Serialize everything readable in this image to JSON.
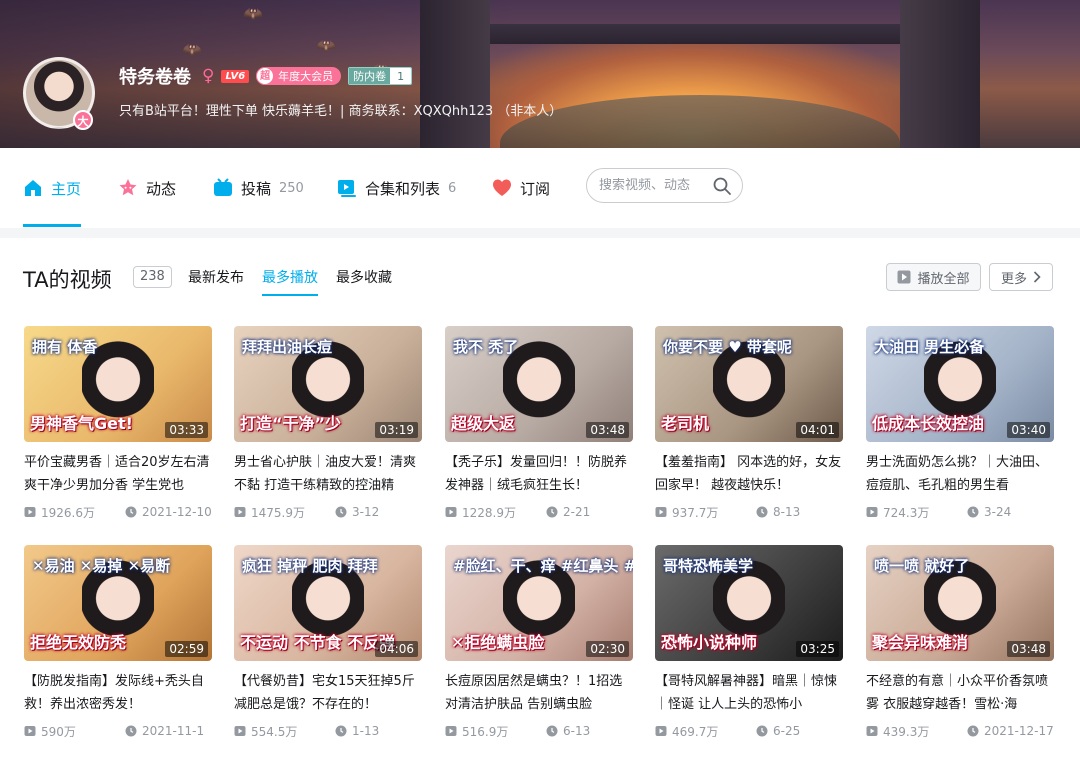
{
  "profile": {
    "name": "特务卷卷",
    "gender_symbol": "♀",
    "level": "LV6",
    "vip_mark": "超",
    "vip_label": "年度大会员",
    "fan_badge_name": "防内卷",
    "fan_badge_level": "1",
    "avatar_badge": "大",
    "sign": "只有B站平台！理性下单 快乐薅羊毛！| 商务联系：XQXQhh123 （非本人）"
  },
  "nav": {
    "items": [
      {
        "label": "主页",
        "count": "",
        "icon": "home-icon"
      },
      {
        "label": "动态",
        "count": "",
        "icon": "dynamic-icon"
      },
      {
        "label": "投稿",
        "count": "250",
        "icon": "upload-icon"
      },
      {
        "label": "合集和列表",
        "count": "6",
        "icon": "collection-icon"
      },
      {
        "label": "订阅",
        "count": "",
        "icon": "heart-icon"
      }
    ],
    "search_placeholder": "搜索视频、动态"
  },
  "colors": {
    "accent": "#00aeec",
    "pink": "#fb7299",
    "text": "#18191c",
    "muted": "#9499a0"
  },
  "videos_section": {
    "title": "TA的视频",
    "count": "238",
    "sort_tabs": [
      "最新发布",
      "最多播放",
      "最多收藏"
    ],
    "active_sort": "最多播放",
    "play_all": "播放全部",
    "more": "更多"
  },
  "videos": [
    {
      "title": "平价宝藏男香｜适合20岁左右清爽干净少男加分香 学生党也",
      "duration": "03:33",
      "plays": "1926.6万",
      "date": "2021-12-10",
      "cap_bottom": "男神香气Get!",
      "cap_top": "拥有    体香"
    },
    {
      "title": "男士省心护肤｜油皮大爱！清爽不黏 打造干练精致的控油精",
      "duration": "03:19",
      "plays": "1475.9万",
      "date": "3-12",
      "cap_bottom": "打造“干净”少",
      "cap_top": "拜拜出油长痘"
    },
    {
      "title": "【秃子乐】发量回归！！防脱养发神器｜绒毛疯狂生长！",
      "duration": "03:48",
      "plays": "1228.9万",
      "date": "2-21",
      "cap_bottom": "超级大返",
      "cap_top": "我不   秃了"
    },
    {
      "title": "【羞羞指南】 冈本选的好，女友回家早！ 越夜越快乐！",
      "duration": "04:01",
      "plays": "937.7万",
      "date": "8-13",
      "cap_bottom": "老司机",
      "cap_top": "你要不要 ♥ 带套呢"
    },
    {
      "title": "男士洗面奶怎么挑？｜大油田、痘痘肌、毛孔粗的男生看",
      "duration": "03:40",
      "plays": "724.3万",
      "date": "3-24",
      "cap_bottom": "低成本长效控油",
      "cap_top": "大油田 男生必备"
    },
    {
      "title": "【防脱发指南】发际线+秃头自救！养出浓密秀发！",
      "duration": "02:59",
      "plays": "590万",
      "date": "2021-11-1",
      "cap_bottom": "拒绝无效防秃",
      "cap_top": "✕易油 ✕易掉 ✕易断"
    },
    {
      "title": "【代餐奶昔】宅女15天狂掉5斤 减肥总是饿？不存在的！",
      "duration": "04:06",
      "plays": "554.5万",
      "date": "1-13",
      "cap_bottom": "不运动 不节食 不反弹",
      "cap_top": "疯狂 掉秤  肥肉 拜拜"
    },
    {
      "title": "长痘原因居然是螨虫？！1招选对清洁护肤品 告别螨虫脸",
      "duration": "02:30",
      "plays": "516.9万",
      "date": "6-13",
      "cap_bottom": "✕拒绝螨虫脸",
      "cap_top": "#脸红、干、痒 #红鼻头 #长痘"
    },
    {
      "title": "【哥特风解暑神器】暗黑｜惊悚｜怪诞 让人上头的恐怖小",
      "duration": "03:25",
      "plays": "469.7万",
      "date": "6-25",
      "cap_bottom": "恐怖小说种师",
      "cap_top": "哥特恐怖美学"
    },
    {
      "title": "不经意的有意｜小众平价香氛喷雾 衣服越穿越香！雪松·海",
      "duration": "03:48",
      "plays": "439.3万",
      "date": "2021-12-17",
      "cap_bottom": "聚会异味难消",
      "cap_top": "喷一喷   就好了"
    }
  ]
}
